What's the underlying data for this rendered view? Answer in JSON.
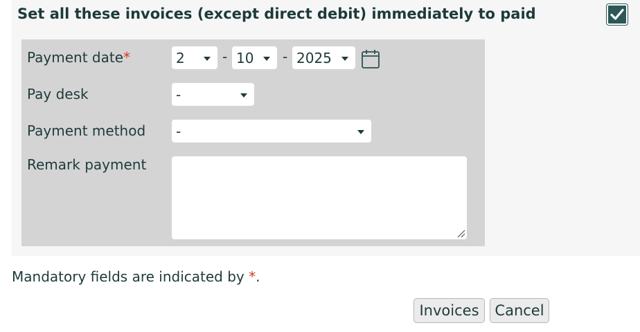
{
  "section": {
    "title": "Set all these invoices (except direct debit) immediately to paid",
    "checked": true
  },
  "form": {
    "payment_date": {
      "label": "Payment date",
      "required_mark": "*",
      "day": "2",
      "month": "10",
      "year": "2025",
      "separator": "-",
      "calendar_icon": "calendar-icon"
    },
    "pay_desk": {
      "label": "Pay desk",
      "value": "-"
    },
    "payment_method": {
      "label": "Payment method",
      "value": "-"
    },
    "remark": {
      "label": "Remark payment",
      "value": ""
    }
  },
  "footer": {
    "mandatory_text": "Mandatory fields are indicated by ",
    "mandatory_mark": "*",
    "mandatory_end": "."
  },
  "buttons": {
    "invoices": "Invoices",
    "cancel": "Cancel"
  },
  "colors": {
    "accent": "#2e5758",
    "required": "#d9391e",
    "panel": "#d4d4d4"
  }
}
